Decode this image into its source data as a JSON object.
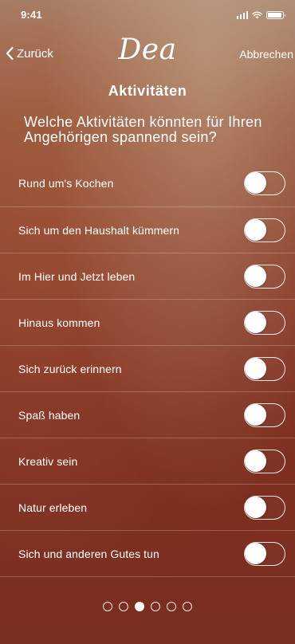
{
  "status_bar": {
    "time": "9:41"
  },
  "nav": {
    "back_label": "Zurück",
    "logo": "Dea",
    "cancel_label": "Abbrechen"
  },
  "page": {
    "title": "Aktivitäten",
    "question": "Welche Aktivitäten könnten für Ihren Angehörigen spannend sein?"
  },
  "activities": [
    {
      "label": "Rund um's Kochen",
      "on": false
    },
    {
      "label": "Sich um den Haushalt kümmern",
      "on": false
    },
    {
      "label": "Im Hier und Jetzt leben",
      "on": false
    },
    {
      "label": "Hinaus kommen",
      "on": false
    },
    {
      "label": "Sich zurück erinnern",
      "on": false
    },
    {
      "label": "Spaß haben",
      "on": false
    },
    {
      "label": "Kreativ sein",
      "on": false
    },
    {
      "label": "Natur erleben",
      "on": false
    },
    {
      "label": "Sich und anderen Gutes tun",
      "on": false
    }
  ],
  "pagination": {
    "total": 6,
    "current": 3
  },
  "colors": {
    "text": "#ffffff",
    "background_top": "#a88470",
    "background_bottom": "#7a2e20"
  }
}
